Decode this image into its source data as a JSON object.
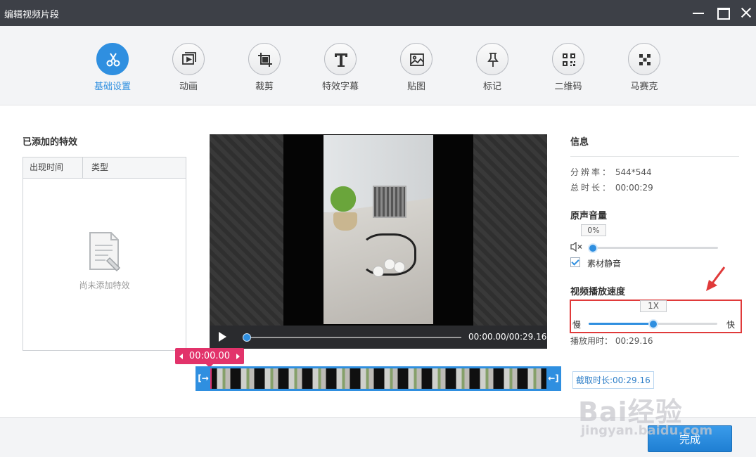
{
  "window": {
    "title": "编辑视频片段"
  },
  "toolbar": {
    "items": [
      {
        "label": "基础设置",
        "icon": "scissors-icon",
        "active": true
      },
      {
        "label": "动画",
        "icon": "animation-icon"
      },
      {
        "label": "裁剪",
        "icon": "crop-icon"
      },
      {
        "label": "特效字幕",
        "icon": "text-icon"
      },
      {
        "label": "贴图",
        "icon": "image-icon"
      },
      {
        "label": "标记",
        "icon": "pin-icon"
      },
      {
        "label": "二维码",
        "icon": "qrcode-icon"
      },
      {
        "label": "马赛克",
        "icon": "mosaic-icon"
      }
    ]
  },
  "effects": {
    "title": "已添加的特效",
    "columns": [
      "出现时间",
      "类型"
    ],
    "empty_text": "尚未添加特效"
  },
  "player": {
    "timecode": "00:00.00/00:29.16",
    "progress": 0
  },
  "timeline": {
    "current_time": "00:00.00",
    "start_marker": "[→",
    "end_marker": "←]",
    "cut_length_label": "截取时长:00:29.16"
  },
  "info": {
    "title": "信息",
    "resolution_key": "分辨率：",
    "resolution_value": "544*544",
    "duration_key": "总时长：",
    "duration_value": "00:00:29"
  },
  "volume": {
    "title": "原声音量",
    "value": "0%",
    "level": 0,
    "mute_label": "素材静音",
    "muted": true
  },
  "speed": {
    "title": "视频播放速度",
    "value": "1X",
    "level": 0.5,
    "slow_label": "慢",
    "fast_label": "快",
    "play_time": "播放用时： 00:29.16"
  },
  "footer": {
    "done_label": "完成"
  },
  "watermark": {
    "line1": "Bai经验",
    "line2": "jingyan.baidu.com"
  },
  "colors": {
    "accent": "#2f8fe0",
    "timeline_marker": "#e2336b",
    "highlight_box": "#e03a3a",
    "titlebar": "#3d4047"
  }
}
